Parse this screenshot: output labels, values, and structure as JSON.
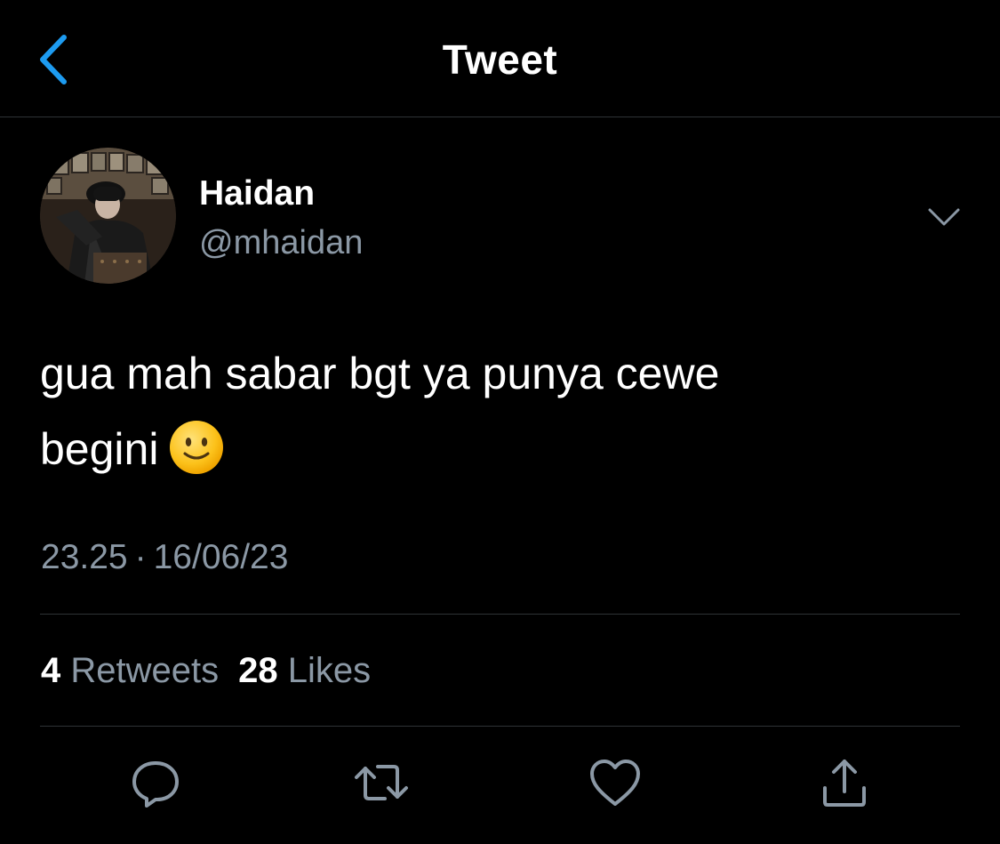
{
  "header": {
    "title": "Tweet",
    "back_icon": "chevron-left-icon"
  },
  "author": {
    "display_name": "Haidan",
    "handle": "@mhaidan",
    "more_icon": "chevron-down-icon"
  },
  "tweet": {
    "text_line1": "gua mah sabar bgt ya punya cewe",
    "text_line2": "begini",
    "emoji": "slightly-smiling-face",
    "time": "23.25",
    "separator": "·",
    "date": "16/06/23"
  },
  "stats": {
    "retweets_count": "4",
    "retweets_label": "Retweets",
    "likes_count": "28",
    "likes_label": "Likes"
  },
  "actions": [
    {
      "name": "reply",
      "icon": "reply-icon"
    },
    {
      "name": "retweet",
      "icon": "retweet-icon"
    },
    {
      "name": "like",
      "icon": "heart-icon"
    },
    {
      "name": "share",
      "icon": "share-icon"
    }
  ],
  "colors": {
    "background": "#000000",
    "text_primary": "#ffffff",
    "text_secondary": "#8b98a5",
    "accent": "#1d9bf0",
    "divider": "#2f3336"
  }
}
